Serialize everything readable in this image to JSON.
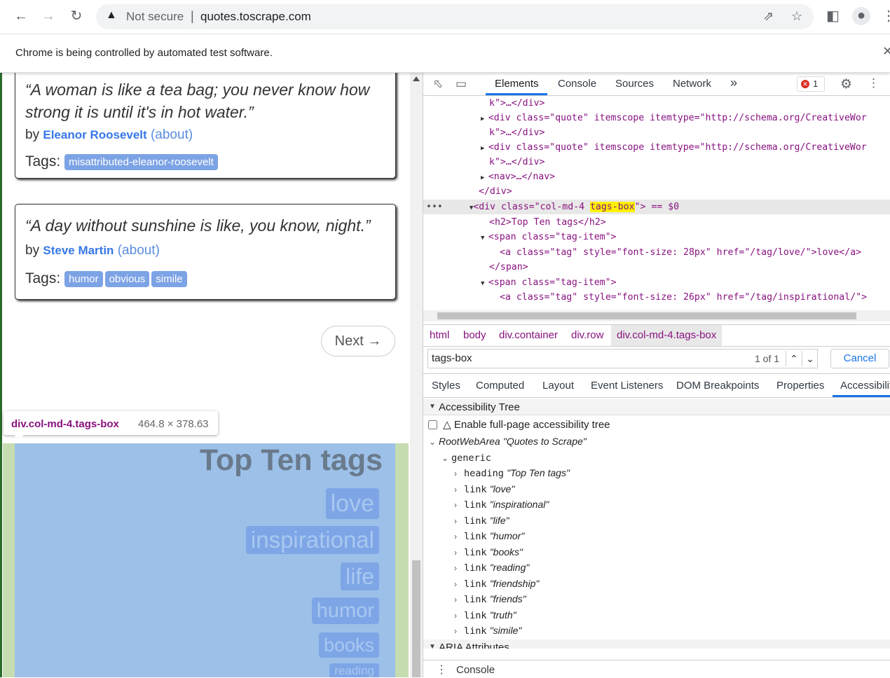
{
  "browser": {
    "security_label": "Not secure",
    "url": "quotes.toscrape.com",
    "automation_notice": "Chrome is being controlled by automated test software."
  },
  "page": {
    "quotes": [
      {
        "text_line1": "“A woman is like a tea bag; you never know how",
        "text_line2": "strong it is until it's in hot water.”",
        "by": "by",
        "author": "Eleanor Roosevelt",
        "about": "(about)",
        "tags_label": "Tags:",
        "tags": [
          "misattributed-eleanor-roosevelt"
        ]
      },
      {
        "text_line1": "“A day without sunshine is like, you know, night.”",
        "by": "by",
        "author": "Steve Martin",
        "about": "(about)",
        "tags_label": "Tags:",
        "tags": [
          "humor",
          "obvious",
          "simile"
        ]
      }
    ],
    "next_label": "Next →",
    "inspect_tooltip": {
      "selector": "div.col-md-4.tags-box",
      "dimensions": "464.8 × 378.63"
    },
    "tags_box": {
      "heading": "Top Ten tags",
      "tags": [
        "love",
        "inspirational",
        "life",
        "humor",
        "books",
        "reading"
      ]
    }
  },
  "devtools": {
    "tabs": [
      "Elements",
      "Console",
      "Sources",
      "Network"
    ],
    "more": "»",
    "error_count": "1",
    "dom_lines": [
      {
        "pre": "k\">…</div>"
      },
      {
        "pre": "<div class=\"quote\" itemscope itemtype=\"http://schema.org/CreativeWor"
      },
      {
        "pre": "k\">…</div>"
      },
      {
        "pre": "<div class=\"quote\" itemscope itemtype=\"http://schema.org/CreativeWor"
      },
      {
        "pre": "k\">…</div>"
      },
      {
        "pre": "<nav>…</nav>"
      },
      {
        "pre": "</div>"
      },
      {
        "pre": "<div class=\"col-md-4 tags-box\"> == $0"
      },
      {
        "pre": "<h2>Top Ten tags</h2>"
      },
      {
        "pre": "<span class=\"tag-item\">"
      },
      {
        "pre": "<a class=\"tag\" style=\"font-size: 28px\" href=\"/tag/love/\">love</a>"
      },
      {
        "pre": "</span>"
      },
      {
        "pre": "<span class=\"tag-item\">"
      },
      {
        "pre": "<a class=\"tag\" style=\"font-size: 26px\" href=\"/tag/inspirational/\">"
      }
    ],
    "breadcrumbs": [
      "html",
      "body",
      "div.container",
      "div.row",
      "div.col-md-4.tags-box"
    ],
    "search": {
      "query": "tags-box",
      "count": "1 of 1",
      "cancel": "Cancel"
    },
    "subtabs": [
      "Styles",
      "Computed",
      "Layout",
      "Event Listeners",
      "DOM Breakpoints",
      "Properties",
      "Accessibility"
    ],
    "accessibility": {
      "tree_title": "Accessibility Tree",
      "full_page_label": "Enable full-page accessibility tree",
      "full_page_checked": false,
      "root_role": "RootWebArea",
      "root_name": "\"Quotes to Scrape\"",
      "generic_role": "generic",
      "nodes": [
        {
          "role": "heading",
          "name": "\"Top Ten tags\""
        },
        {
          "role": "link",
          "name": "\"love\""
        },
        {
          "role": "link",
          "name": "\"inspirational\""
        },
        {
          "role": "link",
          "name": "\"life\""
        },
        {
          "role": "link",
          "name": "\"humor\""
        },
        {
          "role": "link",
          "name": "\"books\""
        },
        {
          "role": "link",
          "name": "\"reading\""
        },
        {
          "role": "link",
          "name": "\"friendship\""
        },
        {
          "role": "link",
          "name": "\"friends\""
        },
        {
          "role": "link",
          "name": "\"truth\""
        },
        {
          "role": "link",
          "name": "\"simile\""
        }
      ],
      "aria_title": "ARIA Attributes"
    },
    "drawer_label": "Console"
  }
}
